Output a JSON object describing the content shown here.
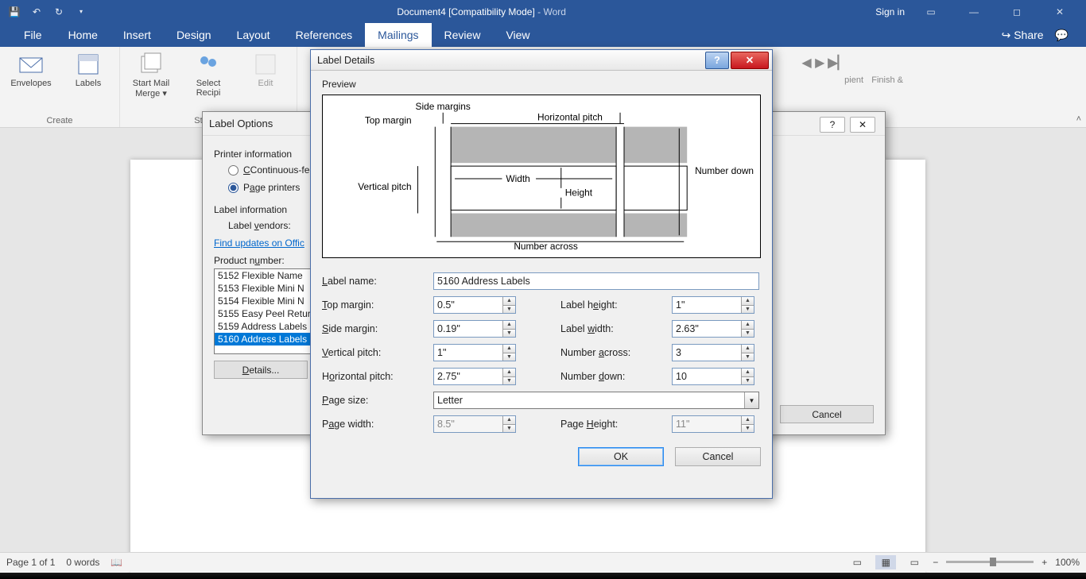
{
  "title": {
    "doc": "Document4 [Compatibility Mode]",
    "app": "Word",
    "dash": "  -  "
  },
  "titlebar_right": {
    "signin": "Sign in"
  },
  "tabs": [
    "File",
    "Home",
    "Insert",
    "Design",
    "Layout",
    "References",
    "Mailings",
    "Review",
    "View"
  ],
  "ribbon_share": "Share",
  "ribbon": {
    "create_group": "Create",
    "envelopes": "Envelopes",
    "labels": "Labels",
    "startmail_l1": "Start Mail",
    "startmail_l2": "Merge ▾",
    "select_l1": "Select",
    "select_l2": "Recipi",
    "edit_l1": "Edit",
    "startmail_group": "Start M",
    "finish": "Finish &",
    "recipient_tail": "pient"
  },
  "label_options": {
    "title": "Label Options",
    "printer_info": "Printer information",
    "continuous": "Continuous-fee",
    "page_printers": "Page printers",
    "label_info": "Label information",
    "vendors_lbl": "Label vendors:",
    "find_updates": "Find updates on Offic",
    "product_number": "Product number:",
    "products": [
      "5152 Flexible Name ",
      "5153 Flexible Mini N",
      "5154 Flexible Mini N",
      "5155 Easy Peel Retur",
      "5159 Address Labels",
      "5160 Address Labels"
    ],
    "details_btn": "Details...",
    "cancel_btn": "Cancel",
    "help_icon": "?",
    "close_icon": "✕"
  },
  "label_details": {
    "title": "Label Details",
    "preview": "Preview",
    "diagram": {
      "side_margins": "Side margins",
      "top_margin": "Top margin",
      "horizontal_pitch": "Horizontal pitch",
      "vertical_pitch": "Vertical pitch",
      "width": "Width",
      "height": "Height",
      "number_down": "Number down",
      "number_across": "Number across"
    },
    "fields": {
      "label_name_lbl": "Label name:",
      "label_name": "5160 Address Labels",
      "top_margin_lbl": "Top margin:",
      "top_margin": "0.5\"",
      "side_margin_lbl": "Side margin:",
      "side_margin": "0.19\"",
      "vpitch_lbl": "Vertical pitch:",
      "vpitch": "1\"",
      "hpitch_lbl": "Horizontal pitch:",
      "hpitch": "2.75\"",
      "label_height_lbl": "Label height:",
      "label_height": "1\"",
      "label_width_lbl": "Label width:",
      "label_width": "2.63\"",
      "num_across_lbl": "Number across:",
      "num_across": "3",
      "num_down_lbl": "Number down:",
      "num_down": "10",
      "page_size_lbl": "Page size:",
      "page_size": "Letter",
      "page_width_lbl": "Page width:",
      "page_width": "8.5\"",
      "page_height_lbl": "Page Height:",
      "page_height": "11\""
    },
    "ok": "OK",
    "cancel": "Cancel"
  },
  "status": {
    "page": "Page 1 of 1",
    "words": "0 words",
    "zoom": "100%"
  }
}
